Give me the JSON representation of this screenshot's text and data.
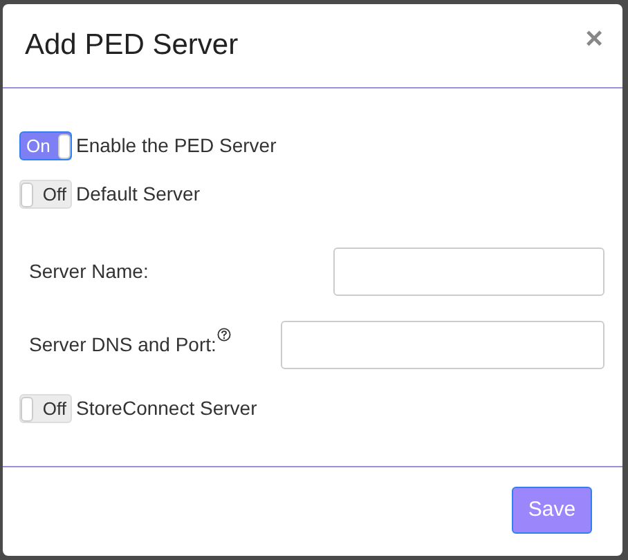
{
  "dialog": {
    "title": "Add PED Server",
    "close": "×"
  },
  "rows": [
    {
      "kind": "toggle",
      "label": "Enable the PED Server",
      "on": true,
      "toggle_text": "On"
    },
    {
      "kind": "toggle",
      "label": "Default Server",
      "on": false,
      "toggle_text": "Off"
    },
    {
      "kind": "field",
      "label": "Server Name:",
      "help": false
    },
    {
      "kind": "field",
      "label": "Server DNS and Port:",
      "help": true
    },
    {
      "kind": "toggle",
      "label": "StoreConnect Server",
      "on": false,
      "toggle_text": "Off"
    }
  ],
  "save_button": "Save"
}
